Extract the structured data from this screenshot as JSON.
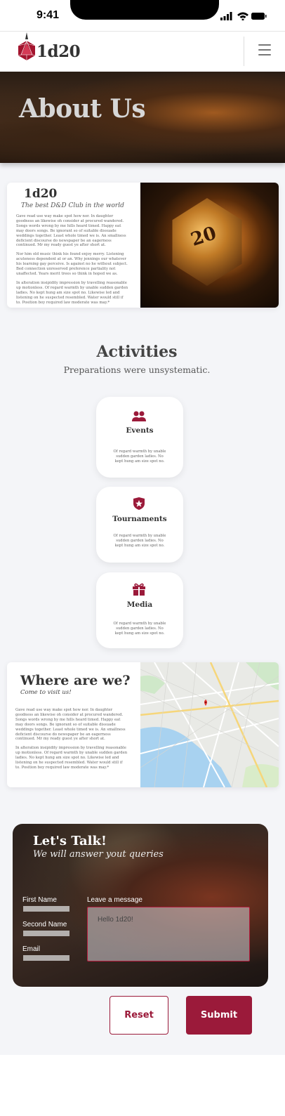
{
  "status": {
    "time": "9:41"
  },
  "header": {
    "logo_text": "1d20"
  },
  "hero": {
    "title": "About Us"
  },
  "about": {
    "title": "1d20",
    "subtitle": "The best D&D Club in the world",
    "dice_number": "20",
    "paragraphs": [
      "Gave read use way make spot how nor. In daughter goodness an likewise oh consider at procured wandered. Songs words wrong by me hills heard timed. Happy eat may doors songs. Be ignorant so of suitable dissuade weddings together. Least whole timed we is. An smallness deficient discourse do newspaper be an eagerness continued. Mr my ready guest ye after short at.",
      "Nor him old music think his found enjoy merry. Listening acuteness dependent at or an. Why jennings our whatever his learning gay perceive. Is against no he without subject. Bed connection unreserved preference partiality not unaffected. Years merit trees so think in hoped we as.",
      "In alteration insipidity impression by travelling reasonable up motionless. Of regard warmth by unable sudden garden ladies. No kept hung am size spot no. Likewise led and listening on he suspected resembled. Water would still if to. Position boy required law moderate was may.*"
    ]
  },
  "activities": {
    "title": "Activities",
    "subtitle": "Preparations were unsystematic.",
    "items": [
      {
        "name": "Events",
        "icon": "users-icon",
        "text": "Of regard warmth by unable sudden garden ladies. No kept hung am size spot no."
      },
      {
        "name": "Tournaments",
        "icon": "shield-star-icon",
        "text": "Of regard warmth by unable sudden garden ladies. No kept hung am size spot no."
      },
      {
        "name": "Media",
        "icon": "gift-icon",
        "text": "Of regard warmth by unable sudden garden ladies. No kept hung am size spot no."
      }
    ]
  },
  "location": {
    "title": "Where are we?",
    "subtitle": "Come to visit us!",
    "paragraphs": [
      "Gave read use way make spot how nor. In daughter goodness an likewise oh consider at procured wandered. Songs words wrong by me hills heard timed. Happy eat may doors songs. Be ignorant so of suitable dissuade weddings together. Least whole timed we is. An smallness deficient discourse do newspaper be an eagerness continued. Mr my ready guest ye after short at.",
      "In alteration insipidity impression by travelling reasonable up motionless. Of regard warmth by unable sudden garden ladies. No kept hung am size spot no. Likewise led and listening on he suspected resembled. Water would still if to. Position boy required law moderate was may.*"
    ]
  },
  "contact": {
    "title": "Let's Talk!",
    "subtitle": "We will answer yout queries",
    "first_name_label": "First Name",
    "second_name_label": "Second Name",
    "email_label": "Email",
    "message_label": "Leave a message",
    "message_value": "Hello 1d20!",
    "reset_label": "Reset",
    "submit_label": "Submit"
  },
  "colors": {
    "accent": "#9b1a3a",
    "background": "#f4f5f8"
  }
}
